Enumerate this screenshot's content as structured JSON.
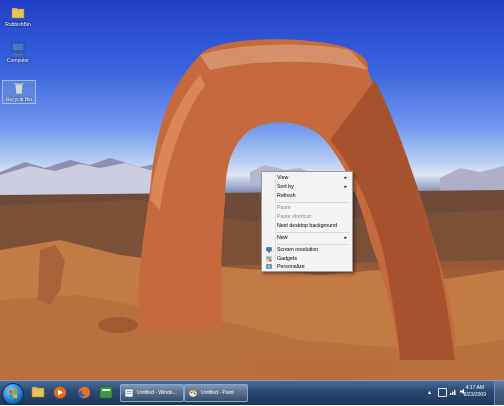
{
  "desktop": {
    "icons": [
      {
        "label": "RubbishBin",
        "icon": "folder-icon"
      },
      {
        "label": "Computer",
        "icon": "computer-icon"
      },
      {
        "label": "Recycle Bin",
        "icon": "recycle-bin-icon"
      }
    ]
  },
  "context_menu": {
    "items": [
      {
        "label": "View",
        "submenu": true,
        "disabled": false
      },
      {
        "label": "Sort by",
        "submenu": true,
        "disabled": false
      },
      {
        "label": "Refresh",
        "submenu": false,
        "disabled": false
      },
      {
        "label": "Paste",
        "submenu": false,
        "disabled": true
      },
      {
        "label": "Paste shortcut",
        "submenu": false,
        "disabled": true
      },
      {
        "label": "Next desktop background",
        "submenu": false,
        "disabled": false
      },
      {
        "label": "New",
        "submenu": true,
        "disabled": false
      },
      {
        "label": "Screen resolution",
        "submenu": false,
        "disabled": false,
        "icon": "screen-resolution-icon"
      },
      {
        "label": "Gadgets",
        "submenu": false,
        "disabled": false,
        "icon": "gadgets-icon"
      },
      {
        "label": "Personalize",
        "submenu": false,
        "disabled": false,
        "icon": "personalize-icon"
      }
    ],
    "submenu_arrow": "▸"
  },
  "taskbar": {
    "pinned": [
      "explorer-icon",
      "media-player-icon",
      "firefox-icon"
    ],
    "buttons": [
      {
        "label": "Untitled - Windo...",
        "icon": "notepad-icon"
      },
      {
        "label": "Untitled - Paint",
        "icon": "paint-icon"
      }
    ],
    "tray": {
      "time": "4:17 AM",
      "date": "8/23/2009"
    }
  },
  "colors": {
    "taskbar": "#2c4a72",
    "menu_bg": "#f3f3f3",
    "sky": "#3a63de"
  }
}
